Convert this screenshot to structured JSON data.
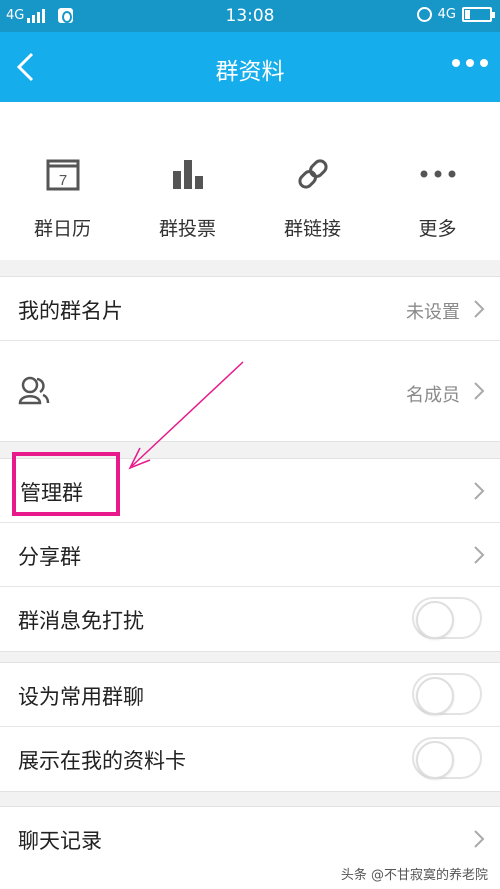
{
  "status_bar": {
    "network": "4G",
    "time": "13:08",
    "network_right": "4G"
  },
  "header": {
    "title": "群资料",
    "back_icon": "chevron-left-icon",
    "more_icon": "more-dots-icon"
  },
  "tools": [
    {
      "label": "群日历",
      "icon": "calendar-icon",
      "icon_text": "7"
    },
    {
      "label": "群投票",
      "icon": "bar-chart-icon"
    },
    {
      "label": "群链接",
      "icon": "link-icon"
    },
    {
      "label": "更多",
      "icon": "more-dots-icon"
    }
  ],
  "rows": {
    "card": {
      "label": "我的群名片",
      "value": "未设置"
    },
    "members": {
      "value": "名成员",
      "icon": "members-icon"
    },
    "manage": {
      "label": "管理群"
    },
    "share": {
      "label": "分享群"
    },
    "mute": {
      "label": "群消息免打扰",
      "on": false
    },
    "common": {
      "label": "设为常用群聊",
      "on": false
    },
    "show_card": {
      "label": "展示在我的资料卡",
      "on": false
    },
    "history": {
      "label": "聊天记录"
    }
  },
  "annotation": {
    "highlight_color": "#e8198b"
  },
  "watermark": "头条 @不甘寂寞的养老院",
  "colors": {
    "status_bar": "#1797c8",
    "title_bar": "#15adeb",
    "background": "#f2f2f2"
  }
}
